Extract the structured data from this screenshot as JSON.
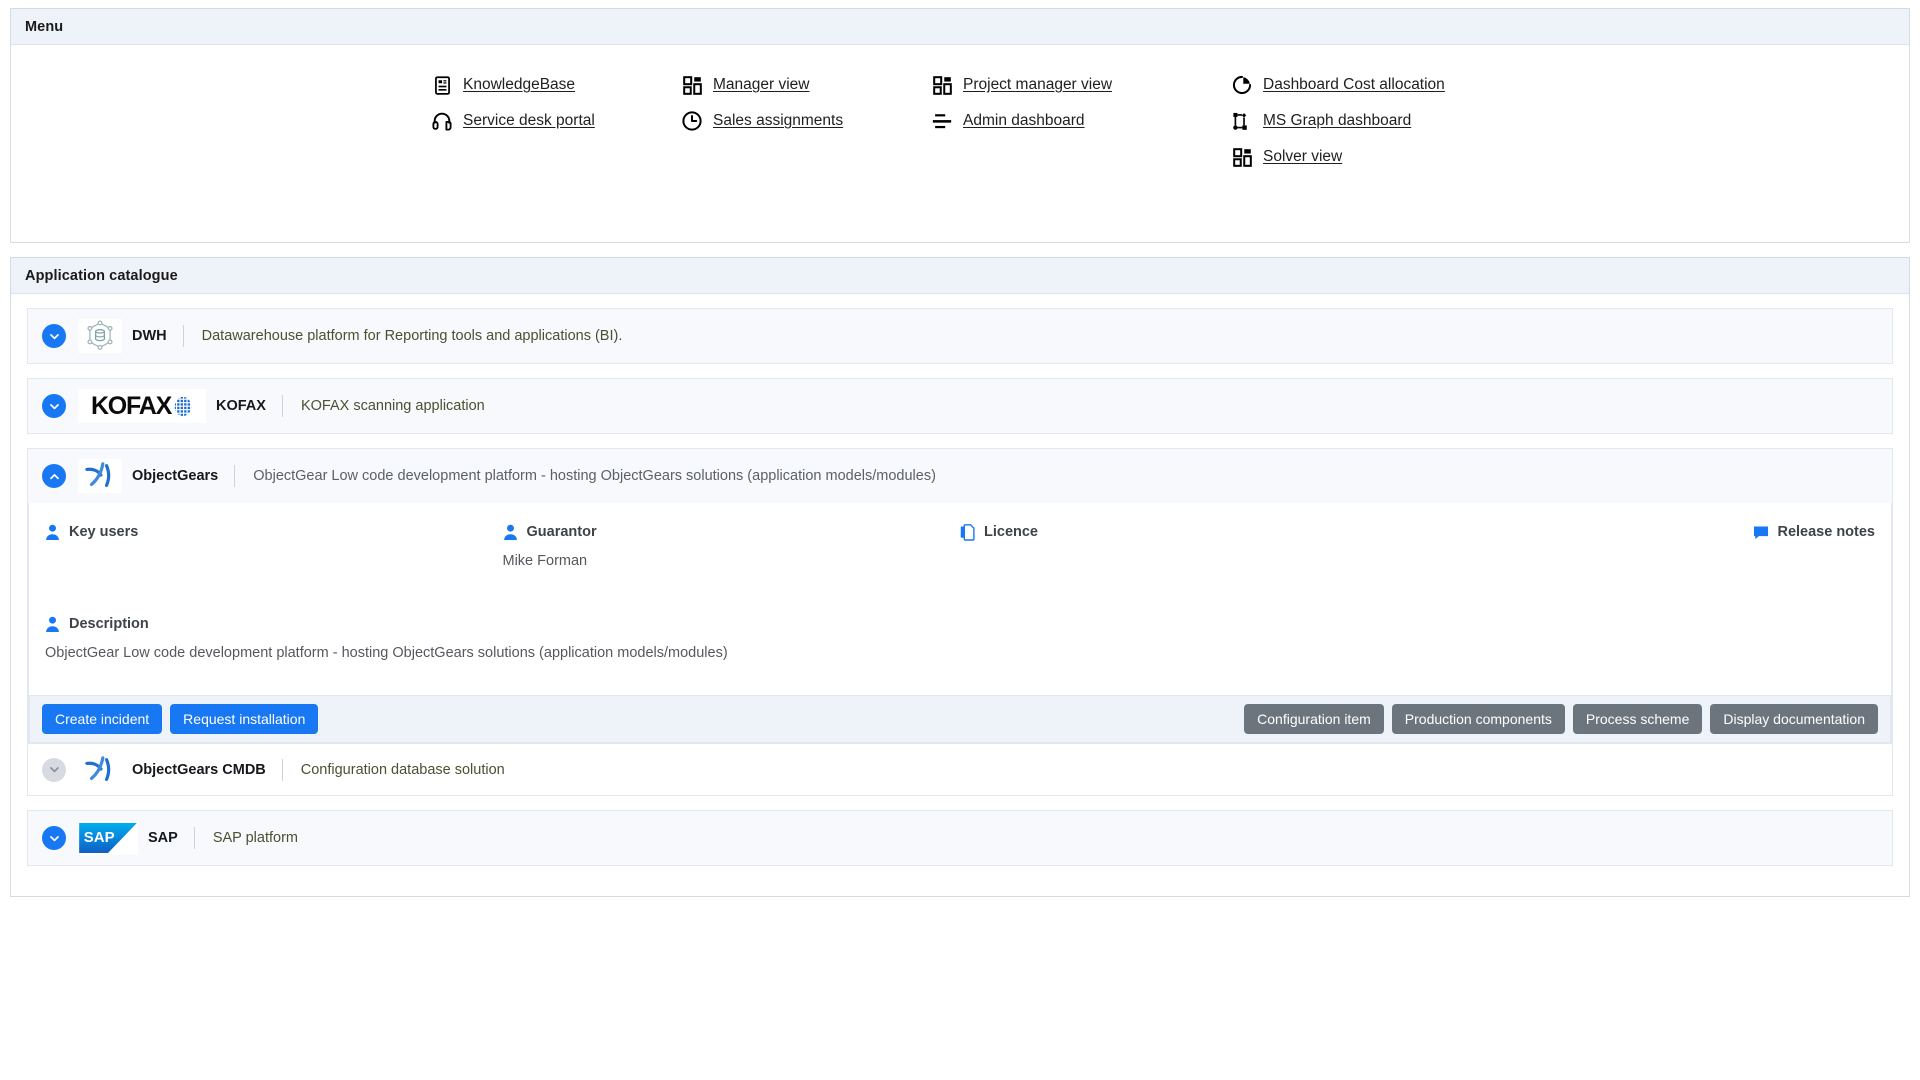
{
  "menu": {
    "title": "Menu",
    "columns": [
      {
        "items": [
          {
            "label": "KnowledgeBase",
            "icon": "article-icon"
          },
          {
            "label": "Service desk portal",
            "icon": "headset-icon"
          }
        ]
      },
      {
        "items": [
          {
            "label": "Manager view",
            "icon": "dashboard-grid-icon"
          },
          {
            "label": "Sales assignments",
            "icon": "clock-icon"
          }
        ]
      },
      {
        "items": [
          {
            "label": "Project manager view",
            "icon": "dashboard-grid-icon"
          },
          {
            "label": "Admin dashboard",
            "icon": "list-lines-icon"
          }
        ]
      },
      {
        "items": [
          {
            "label": "Dashboard Cost allocation",
            "icon": "pie-chart-icon"
          },
          {
            "label": "MS Graph dashboard",
            "icon": "graph-nodes-icon"
          },
          {
            "label": "Solver view",
            "icon": "dashboard-grid-icon"
          }
        ]
      }
    ]
  },
  "catalogue": {
    "title": "Application catalogue",
    "apps": [
      {
        "key": "dwh",
        "name": "DWH",
        "description": "Datawarehouse platform for Reporting tools and applications (BI).",
        "expanded": false,
        "chevron": "chevron-down-icon",
        "chevron_state": "active"
      },
      {
        "key": "kofax",
        "name": "KOFAX",
        "logo_text": "KOFAX",
        "description": "KOFAX scanning application",
        "expanded": false,
        "chevron": "chevron-down-icon",
        "chevron_state": "active"
      },
      {
        "key": "objectgears",
        "name": "ObjectGears",
        "description": "ObjectGear Low code development platform - hosting ObjectGears solutions (application models/modules)",
        "expanded": true,
        "chevron": "chevron-up-icon",
        "chevron_state": "active",
        "detail": {
          "fields": [
            {
              "label": "Key users",
              "icon": "person-icon",
              "value": ""
            },
            {
              "label": "Guarantor",
              "icon": "person-icon",
              "value": "Mike Forman"
            },
            {
              "label": "Licence",
              "icon": "documents-icon",
              "value": ""
            },
            {
              "label": "Release notes",
              "icon": "speech-bubble-icon",
              "value": ""
            }
          ],
          "description_label": "Description",
          "description_icon": "person-icon",
          "description_text": "ObjectGear Low code development platform - hosting ObjectGears solutions (application models/modules)",
          "primary_buttons": [
            {
              "label": "Create incident"
            },
            {
              "label": "Request installation"
            }
          ],
          "secondary_buttons": [
            {
              "label": "Configuration item"
            },
            {
              "label": "Production components"
            },
            {
              "label": "Process scheme"
            },
            {
              "label": "Display documentation"
            }
          ]
        }
      },
      {
        "key": "objectgears-cmdb",
        "name": "ObjectGears CMDB",
        "description": "Configuration database solution",
        "expanded": false,
        "chevron": "chevron-down-icon",
        "chevron_state": "muted"
      },
      {
        "key": "sap",
        "name": "SAP",
        "logo_text": "SAP",
        "description": "SAP platform",
        "expanded": false,
        "chevron": "chevron-down-icon",
        "chevron_state": "active"
      }
    ]
  },
  "colors": {
    "accent_blue": "#1877f2",
    "gray_button": "#6c757d",
    "panel_head_bg": "#eef2f9",
    "desc_olive": "#4d4f32",
    "desc_gray": "#5c6066"
  }
}
